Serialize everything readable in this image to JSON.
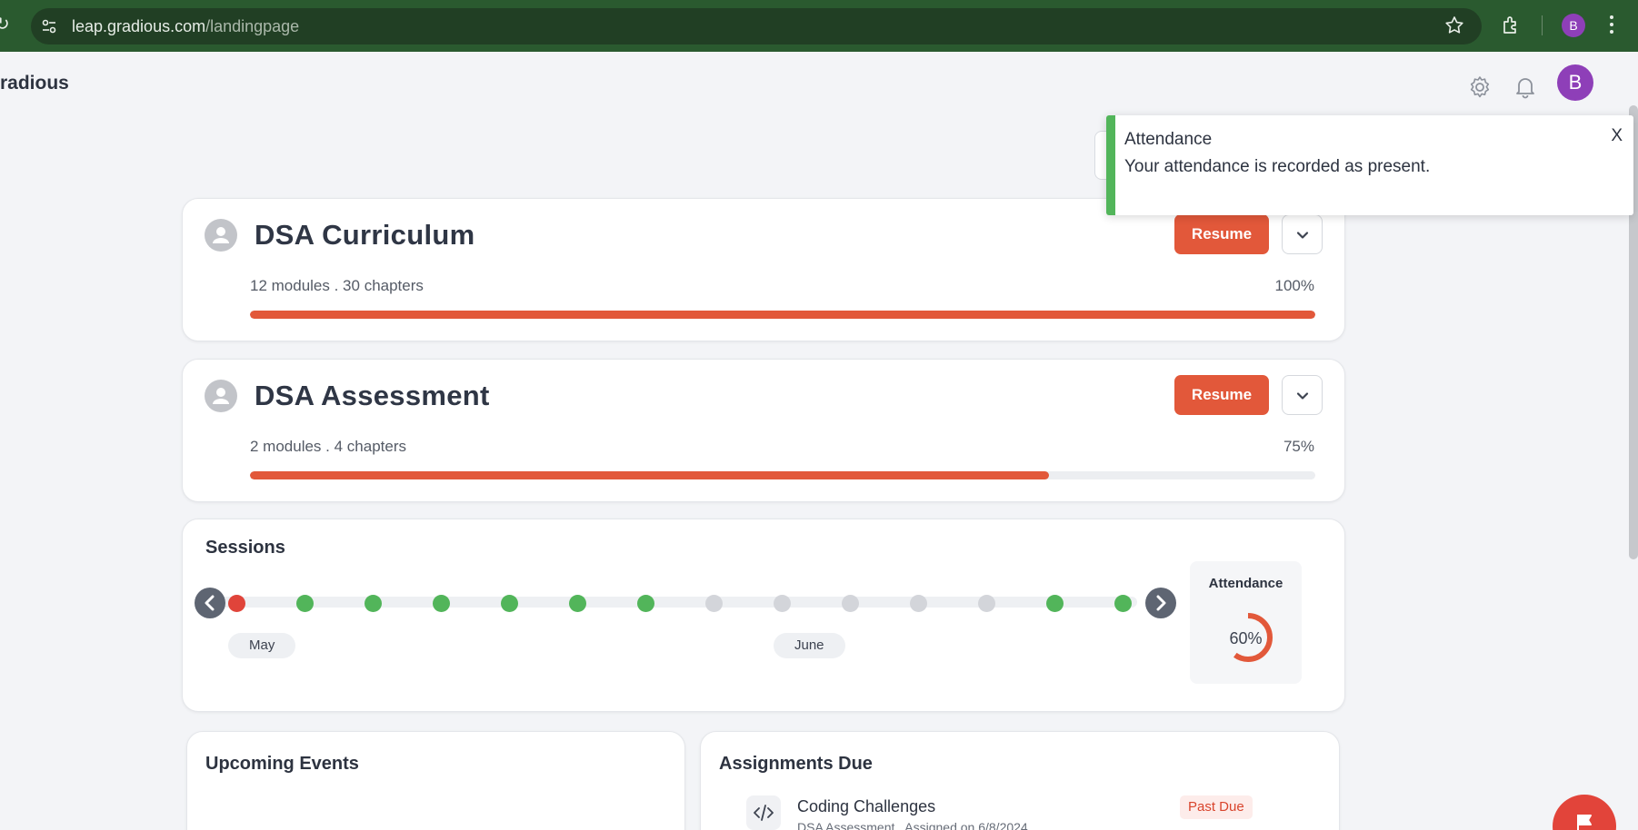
{
  "browser": {
    "url_host": "leap.gradious.com",
    "url_path": "/landingpage",
    "profile_initial": "B"
  },
  "header": {
    "brand": "radious",
    "avatar_initial": "B"
  },
  "courses": [
    {
      "title": "DSA Curriculum",
      "meta": "12 modules . 30 chapters",
      "percent_label": "100%",
      "progress": 1.0,
      "resume_label": "Resume"
    },
    {
      "title": "DSA Assessment",
      "meta": "2 modules . 4 chapters",
      "percent_label": "75%",
      "progress": 0.75,
      "resume_label": "Resume"
    }
  ],
  "sessions": {
    "title": "Sessions",
    "statuses": [
      "absent",
      "present",
      "present",
      "present",
      "present",
      "present",
      "present",
      "none",
      "none",
      "none",
      "none",
      "none",
      "present",
      "present"
    ],
    "months": [
      "May",
      "June"
    ],
    "attendance_label": "Attendance",
    "attendance_percent_label": "60%",
    "attendance_value": 0.6
  },
  "events": {
    "title": "Upcoming Events"
  },
  "assignments": {
    "title": "Assignments Due",
    "items": [
      {
        "name": "Coding Challenges",
        "sub": "DSA Assessment . Assigned on 6/8/2024",
        "status": "Past Due"
      }
    ]
  },
  "toast": {
    "title": "Attendance",
    "message": "Your attendance is recorded as present.",
    "close_label": "X"
  },
  "colors": {
    "accent": "#e2583a",
    "present": "#52b55a",
    "absent": "#e0443a",
    "none": "#d3d5da",
    "avatar": "#8e3fb8"
  }
}
